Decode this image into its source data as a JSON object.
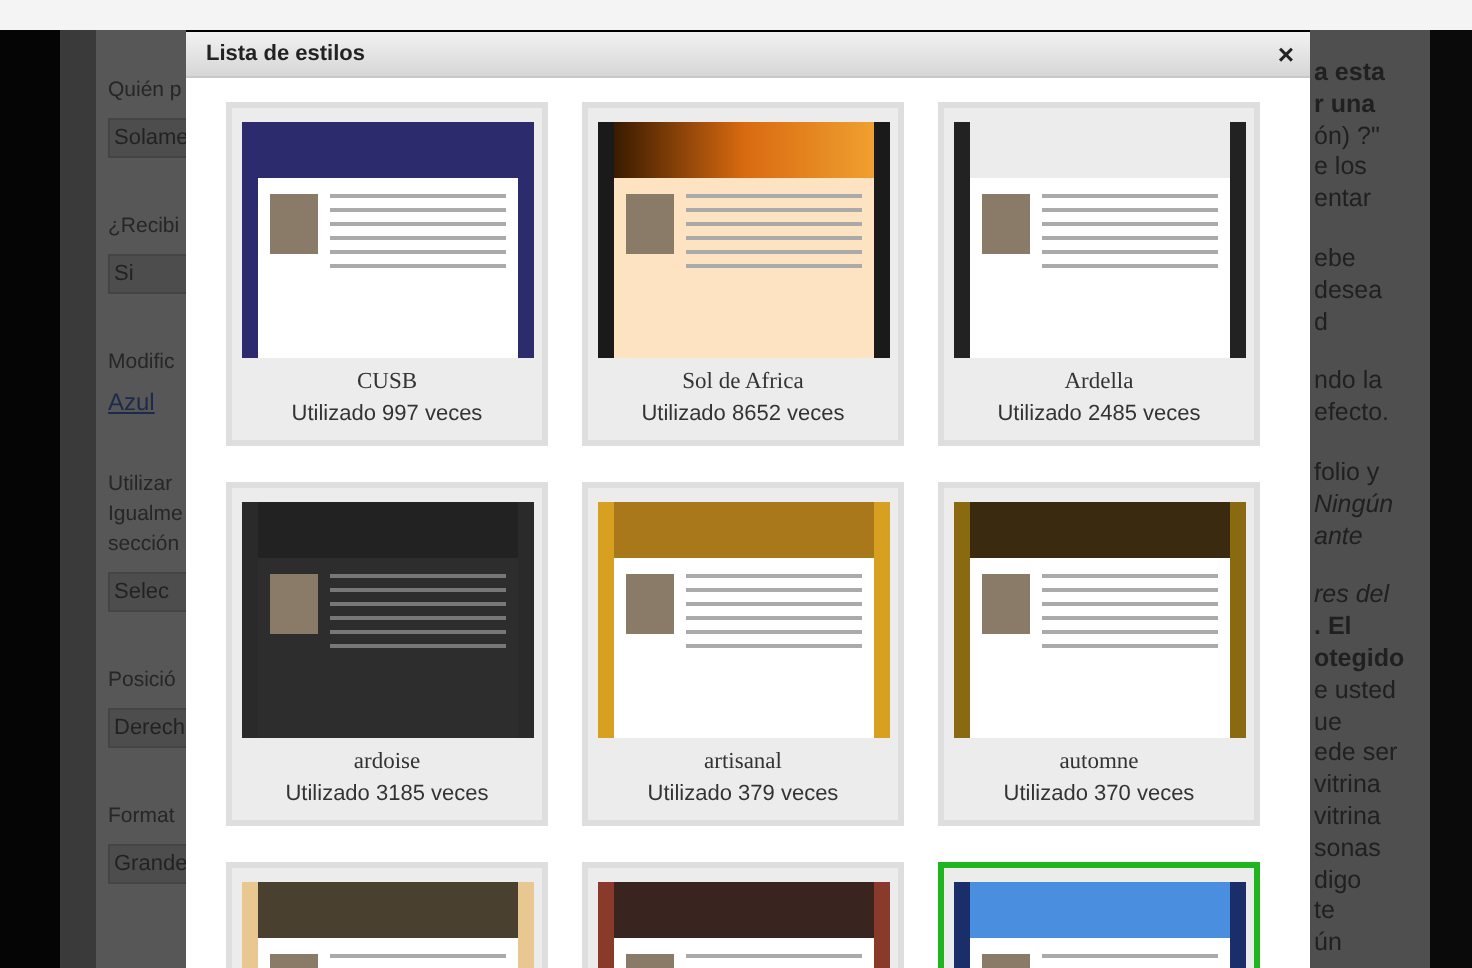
{
  "background_form": {
    "sections": [
      {
        "label_lines": [
          "Quién p"
        ],
        "control": {
          "kind": "select",
          "value": "Solame"
        }
      },
      {
        "label_lines": [
          "¿Recibi"
        ],
        "control": {
          "kind": "select",
          "value": "Si"
        }
      },
      {
        "label_lines": [
          "Modific"
        ],
        "control": {
          "kind": "link",
          "value": "Azul"
        }
      },
      {
        "label_lines": [
          "Utilizar",
          "Igualme",
          "sección"
        ],
        "control": {
          "kind": "select",
          "value": "Selec"
        }
      },
      {
        "label_lines": [
          "Posició"
        ],
        "control": {
          "kind": "select",
          "value": "Derech"
        }
      },
      {
        "label_lines": [
          "Format"
        ],
        "control": {
          "kind": "select",
          "value": "Grande"
        }
      }
    ]
  },
  "background_text": {
    "paragraphs": [
      [
        {
          "text": "a esta",
          "kind": "bold"
        },
        {
          "text": "r una",
          "kind": "bold"
        },
        {
          "text": "ón) ?\"",
          "kind": "plain"
        },
        {
          "text": "e los",
          "kind": "plain"
        },
        {
          "text": "entar",
          "kind": "plain"
        }
      ],
      [
        {
          "text": "ebe",
          "kind": "plain"
        },
        {
          "text": "desea",
          "kind": "plain"
        },
        {
          "text": "d",
          "kind": "plain"
        }
      ],
      [
        {
          "text": "ndo la",
          "kind": "plain"
        },
        {
          "text": "efecto.",
          "kind": "plain"
        }
      ],
      [
        {
          "text": "folio y",
          "kind": "plain"
        },
        {
          "text": "Ningún",
          "kind": "italic"
        },
        {
          "text": "ante",
          "kind": "italic"
        }
      ],
      [
        {
          "text": "res del",
          "kind": "italic"
        },
        {
          "text": ". El",
          "kind": "bold"
        },
        {
          "text": "otegido",
          "kind": "bold"
        },
        {
          "text": "e usted",
          "kind": "plain"
        },
        {
          "text": "ue",
          "kind": "plain"
        },
        {
          "text": "ede ser",
          "kind": "plain"
        },
        {
          "text": "vitrina",
          "kind": "plain"
        },
        {
          "text": "vitrina",
          "kind": "plain"
        },
        {
          "text": "sonas",
          "kind": "plain"
        },
        {
          "text": "digo",
          "kind": "plain"
        },
        {
          "text": "te",
          "kind": "plain"
        },
        {
          "text": "ún",
          "kind": "plain"
        }
      ]
    ]
  },
  "dialog": {
    "title": "Lista de estilos",
    "close": "×",
    "styles": [
      {
        "kind": "navy",
        "name": "CUSB",
        "count": "Utilizado 997 veces",
        "selected": false
      },
      {
        "kind": "sunset",
        "name": "Sol de Africa",
        "count": "Utilizado 8652 veces",
        "selected": false
      },
      {
        "kind": "lace",
        "name": "Ardella",
        "count": "Utilizado 2485 veces",
        "selected": false
      },
      {
        "kind": "slate",
        "name": "ardoise",
        "count": "Utilizado 3185 veces",
        "selected": false
      },
      {
        "kind": "mosaic",
        "name": "artisanal",
        "count": "Utilizado 379 veces",
        "selected": false
      },
      {
        "kind": "autumn",
        "name": "automne",
        "count": "Utilizado 370 veces",
        "selected": false
      },
      {
        "kind": "floral",
        "selected": false
      },
      {
        "kind": "mandala",
        "selected": false
      },
      {
        "kind": "sky",
        "selected": true
      }
    ]
  }
}
